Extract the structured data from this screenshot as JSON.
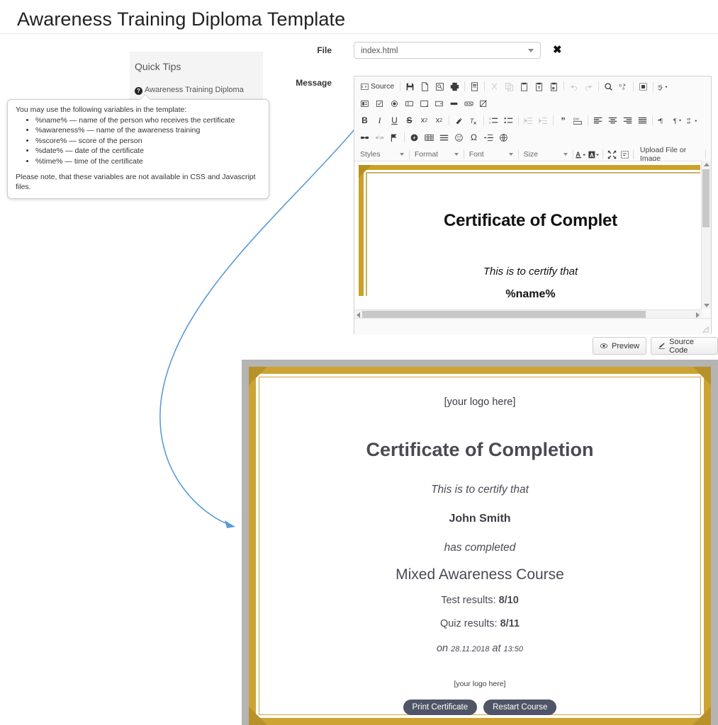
{
  "page": {
    "title": "Awareness Training Diploma Template"
  },
  "quick_tips": {
    "heading": "Quick Tips",
    "item_label": "Awareness Training Diploma",
    "item_icon": "question-mark-icon"
  },
  "tooltip": {
    "intro": "You may use the following variables in the template:",
    "variables": [
      "%name% — name of the person who receives the certificate",
      "%awareness% — name of the awareness training",
      "%score% — score of the person",
      "%date% — date of the certificate",
      "%time% — time of the certificate"
    ],
    "note": "Please note, that these variables are not available in CSS and Javascript files."
  },
  "form": {
    "file_label": "File",
    "file_value": "index.html",
    "clear_icon": "close-x-icon",
    "message_label": "Message"
  },
  "editor": {
    "toolbar_rows": [
      [
        {
          "icon": "source-icon",
          "label": "Source",
          "type": "text"
        },
        {
          "type": "sep"
        },
        {
          "icon": "save-icon"
        },
        {
          "icon": "new-page-icon"
        },
        {
          "icon": "preview-icon"
        },
        {
          "icon": "print-icon"
        },
        {
          "type": "sep"
        },
        {
          "icon": "templates-icon"
        },
        {
          "type": "sep"
        },
        {
          "icon": "cut-icon",
          "dim": true
        },
        {
          "icon": "copy-icon",
          "dim": true
        },
        {
          "icon": "paste-icon"
        },
        {
          "icon": "paste-text-icon"
        },
        {
          "icon": "paste-word-icon"
        },
        {
          "type": "sep"
        },
        {
          "icon": "undo-icon",
          "dim": true
        },
        {
          "icon": "redo-icon",
          "dim": true
        },
        {
          "type": "sep"
        },
        {
          "icon": "find-icon"
        },
        {
          "icon": "replace-icon"
        },
        {
          "type": "sep"
        },
        {
          "icon": "select-all-icon"
        },
        {
          "type": "sep"
        },
        {
          "icon": "spellcheck-icon",
          "caret": true
        }
      ],
      [
        {
          "icon": "form-icon"
        },
        {
          "icon": "checkbox-icon"
        },
        {
          "icon": "radio-icon"
        },
        {
          "icon": "text-field-icon"
        },
        {
          "icon": "textarea-icon"
        },
        {
          "icon": "select-field-icon"
        },
        {
          "icon": "button-icon"
        },
        {
          "icon": "image-button-icon"
        },
        {
          "icon": "hidden-field-icon"
        }
      ],
      [
        {
          "icon": "bold-icon",
          "label": "B"
        },
        {
          "icon": "italic-icon",
          "label": "I"
        },
        {
          "icon": "underline-icon",
          "label": "U"
        },
        {
          "icon": "strike-icon",
          "label": "S"
        },
        {
          "icon": "subscript-icon"
        },
        {
          "icon": "superscript-icon"
        },
        {
          "type": "sep"
        },
        {
          "icon": "copy-formatting-icon"
        },
        {
          "icon": "remove-format-icon"
        },
        {
          "type": "sep"
        },
        {
          "icon": "numbered-list-icon"
        },
        {
          "icon": "bulleted-list-icon"
        },
        {
          "type": "sep"
        },
        {
          "icon": "outdent-icon",
          "dim": true
        },
        {
          "icon": "indent-icon",
          "dim": true
        },
        {
          "type": "sep"
        },
        {
          "icon": "blockquote-icon"
        },
        {
          "icon": "div-container-icon"
        },
        {
          "type": "sep"
        },
        {
          "icon": "align-left-icon"
        },
        {
          "icon": "align-center-icon"
        },
        {
          "icon": "align-right-icon"
        },
        {
          "icon": "justify-icon"
        },
        {
          "type": "sep"
        },
        {
          "icon": "ltr-icon"
        },
        {
          "icon": "rtl-icon"
        },
        {
          "icon": "language-icon",
          "caret": true
        }
      ],
      [
        {
          "icon": "link-icon"
        },
        {
          "icon": "unlink-icon",
          "dim": true
        },
        {
          "icon": "anchor-icon"
        },
        {
          "type": "sep"
        },
        {
          "icon": "flash-icon"
        },
        {
          "icon": "table-icon"
        },
        {
          "icon": "horizontal-rule-icon"
        },
        {
          "icon": "smiley-icon"
        },
        {
          "icon": "special-char-icon"
        },
        {
          "icon": "page-break-icon"
        },
        {
          "icon": "iframe-icon"
        }
      ]
    ],
    "combos": [
      {
        "label": "Styles"
      },
      {
        "label": "Format"
      },
      {
        "label": "Font"
      },
      {
        "label": "Size"
      }
    ],
    "color_buttons": [
      {
        "icon": "text-color-icon",
        "label": "A"
      },
      {
        "icon": "background-color-icon",
        "label": "A"
      }
    ],
    "extra_buttons": [
      {
        "icon": "maximize-icon"
      },
      {
        "icon": "show-blocks-icon"
      }
    ],
    "upload_label": "Upload File or Image",
    "canvas": {
      "heading": "Certificate of Complet",
      "certify": "This is to certify that",
      "name": "%name%"
    },
    "buttons": [
      {
        "icon": "eye-icon",
        "label": "Preview"
      },
      {
        "icon": "code-icon",
        "label": "Source Code"
      }
    ]
  },
  "certificate": {
    "logo_top": "[your logo here]",
    "heading": "Certificate of Completion",
    "certify": "This is to certify that",
    "name": "John Smith",
    "completed": "has completed",
    "course": "Mixed Awareness Course",
    "test_label": "Test results:",
    "test_value": "8/10",
    "quiz_label": "Quiz results:",
    "quiz_value": "8/11",
    "on_label": "on",
    "date": "28.11.2018",
    "at_label": "at",
    "time": "13:50",
    "logo_bottom": "[your logo here]",
    "print_button": "Print Certificate",
    "restart_button": "Restart Course"
  },
  "colors": {
    "gold": "#cda434",
    "gold_dark": "#b9912a",
    "frame_gray": "#b4b4b4",
    "button_slate": "#4f5566",
    "arrow_blue": "#5b9bd5"
  }
}
